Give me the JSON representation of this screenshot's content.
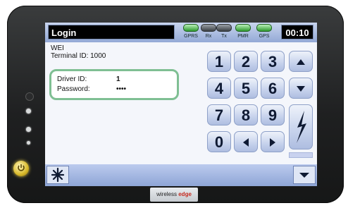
{
  "header": {
    "title": "Login",
    "indicators": [
      {
        "label": "GPRS",
        "state": "on",
        "icon": "led-lamp"
      },
      {
        "label": "Rx",
        "state": "off",
        "icon": "led-lamp"
      },
      {
        "label": "Tx",
        "state": "off",
        "icon": "led-lamp"
      },
      {
        "label": "PMR",
        "state": "on",
        "icon": "led-lamp"
      },
      {
        "label": "GPS",
        "state": "on",
        "icon": "led-lamp"
      }
    ],
    "time": "00:10"
  },
  "info": {
    "company": "WEI",
    "terminal_id": "Terminal ID: 1000"
  },
  "credentials": {
    "driver_label": "Driver ID:",
    "driver_value": "1",
    "password_label": "Password:",
    "password_value": "••••"
  },
  "keypad": {
    "digits": [
      "1",
      "2",
      "3",
      "4",
      "5",
      "6",
      "7",
      "8",
      "9",
      "0"
    ],
    "icons": {
      "up": "triangle-up-icon",
      "down": "triangle-down-icon",
      "left": "arrow-left-icon",
      "right": "arrow-right-icon",
      "enter": "lightning-icon"
    }
  },
  "bottom_bar": {
    "left_icon": "asterisk-star-icon",
    "right_icon": "menu-down-icon"
  },
  "brand": {
    "text_1": "wireless",
    "text_2": "edge"
  },
  "colors": {
    "frame": "#1f2021",
    "accent_green": "#7fbf93",
    "key_blue": "#c6d2ec",
    "title_bar_blue": "#93a9d6",
    "brand_red": "#c62a1f",
    "power_gold": "#d8b92a"
  }
}
